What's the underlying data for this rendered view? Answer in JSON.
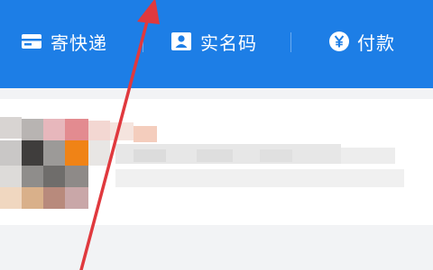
{
  "quick_actions": [
    {
      "label": "寄快递",
      "icon": "package-icon"
    },
    {
      "label": "实名码",
      "icon": "id-card-icon"
    },
    {
      "label": "付款",
      "icon": "yuan-icon"
    }
  ],
  "colors": {
    "top_bar": "#1d7ee6",
    "annotation_arrow": "#e0393e"
  },
  "card": {
    "content": "redacted"
  }
}
